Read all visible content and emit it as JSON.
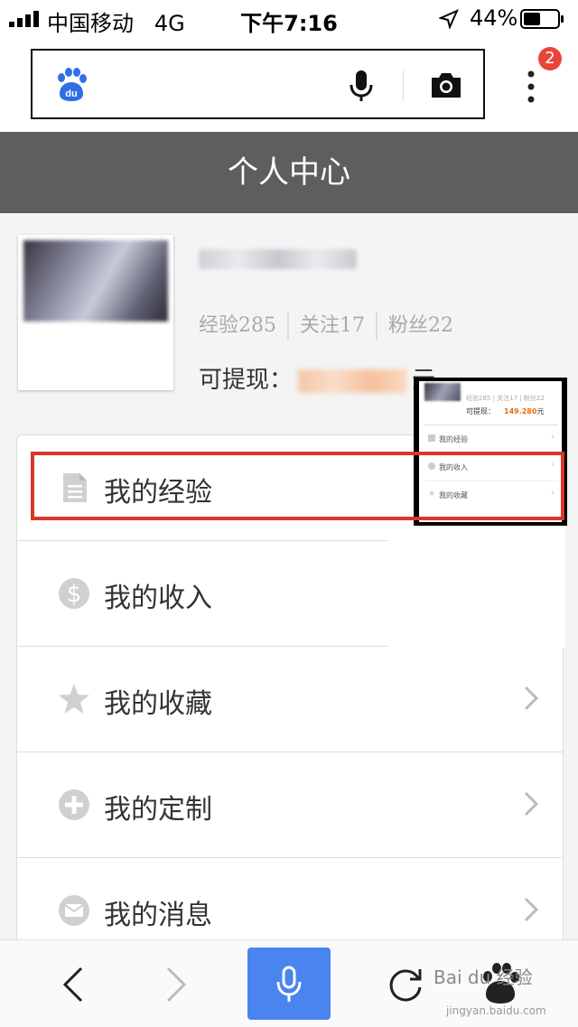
{
  "status_bar": {
    "carrier": "中国移动",
    "network": "4G",
    "time": "下午7:16",
    "battery": "44%"
  },
  "browser": {
    "notification_count": "2"
  },
  "header": {
    "title": "个人中心"
  },
  "profile": {
    "stats": {
      "experience": "经验285",
      "following": "关注17",
      "fans": "粉丝22"
    },
    "withdraw_label": "可提现：",
    "withdraw_unit": "元"
  },
  "menu": {
    "items": [
      {
        "label": "我的经验",
        "icon": "document-icon"
      },
      {
        "label": "我的收入",
        "icon": "dollar-icon"
      },
      {
        "label": "我的收藏",
        "icon": "star-icon"
      },
      {
        "label": "我的定制",
        "icon": "plus-icon"
      },
      {
        "label": "我的消息",
        "icon": "mail-icon"
      }
    ]
  },
  "thumbnail": {
    "stats": "经验285 | 关注17 | 粉丝22",
    "withdraw_label": "可提现：",
    "amount": "149.280",
    "unit": "元",
    "items": [
      "我的经验",
      "我的收入",
      "我的收藏"
    ]
  },
  "watermark": {
    "text": "Bai du 经验",
    "url": "jingyan.baidu.com"
  },
  "colors": {
    "header_bg": "#5d5e60",
    "accent_blue": "#4a85ef",
    "highlight_red": "#d9362a",
    "badge_red": "#e8453c"
  }
}
